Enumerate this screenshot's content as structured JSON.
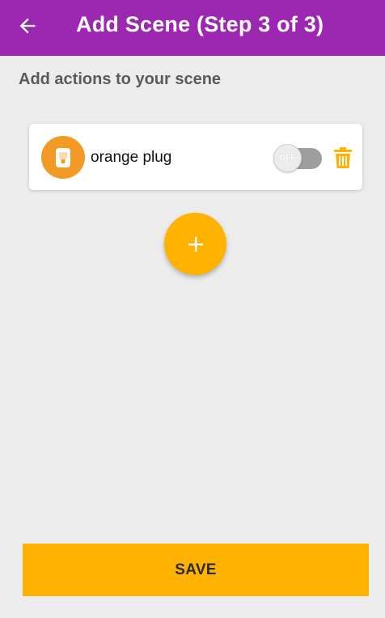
{
  "header": {
    "title": "Add Scene (Step 3 of 3)",
    "back_icon": "arrow-left-icon"
  },
  "main": {
    "section_title": "Add actions to your scene",
    "actions": [
      {
        "device_name": "orange plug",
        "device_icon": "plug-icon",
        "toggle_state": "OFF",
        "delete_icon": "trash-icon"
      }
    ],
    "add_icon": "plus-icon"
  },
  "footer": {
    "save_label": "SAVE"
  },
  "colors": {
    "app_bar": "#9c27b0",
    "accent": "#ffb300",
    "device_avatar": "#f39a26",
    "background": "#ececec"
  }
}
